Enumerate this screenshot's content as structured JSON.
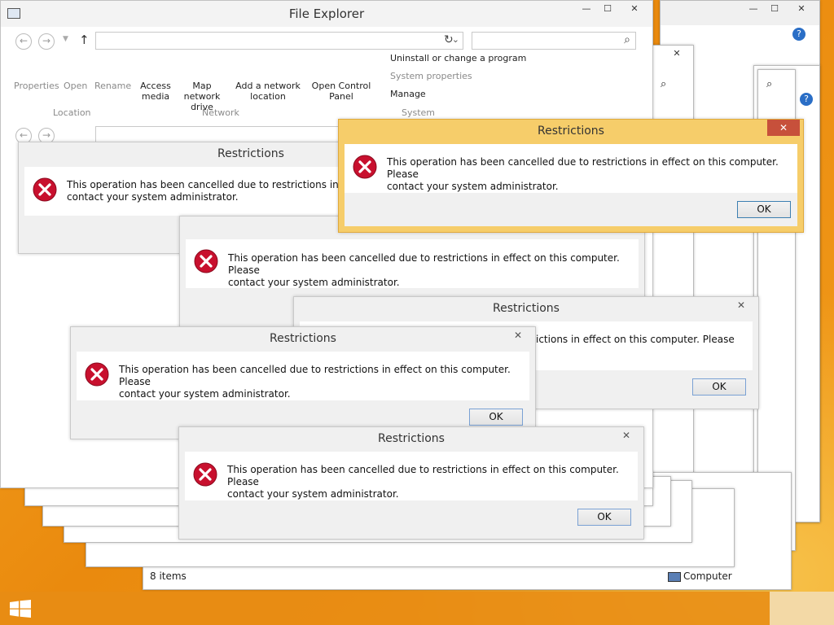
{
  "file_explorer": {
    "title": "File Explorer",
    "ribbon": {
      "items": [
        {
          "label": "Properties"
        },
        {
          "label": "Open"
        },
        {
          "label": "Rename"
        },
        {
          "label": "Access\nmedia"
        },
        {
          "label": "Map network\ndrive"
        },
        {
          "label": "Add a network\nlocation"
        },
        {
          "label": "Open Control\nPanel"
        }
      ],
      "system_items": [
        {
          "label": "Uninstall or change a program"
        },
        {
          "label": "System properties"
        },
        {
          "label": "Manage"
        }
      ],
      "groups": [
        "Location",
        "Network",
        "System"
      ]
    },
    "status": {
      "items": "8 items",
      "location": "Computer",
      "location_partial": "puter"
    }
  },
  "dialogs": {
    "title": "Restrictions",
    "message": "This operation has been cancelled due to restrictions in effect on this computer. Please contact your system administrator.",
    "message_line1": "This operation has been cancelled due to restrictions in effect on this computer. Please",
    "message_line2": "contact your system administrator.",
    "message_partial_line1": "This operation has been cancelled due to restrictions in effect o",
    "message_partial_right": "ictions in effect on this computer. Please",
    "ok_label": "OK",
    "close_glyph": "✕"
  },
  "colors": {
    "active_title": "#f6cd6a",
    "close_active": "#c7503b",
    "error_red": "#c8102e",
    "desktop": "#ea8a0e"
  },
  "icons": {
    "error": "error-icon",
    "windows_start": "windows-logo-icon",
    "search": "search-icon",
    "refresh": "refresh-icon",
    "help": "help-icon"
  }
}
